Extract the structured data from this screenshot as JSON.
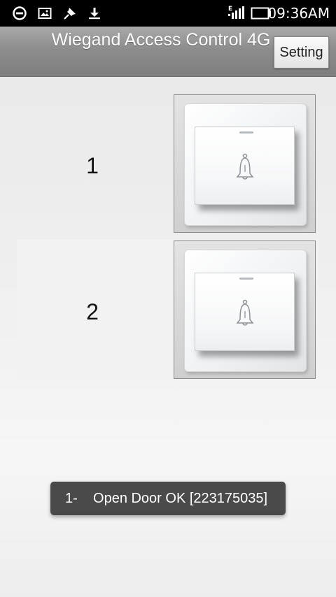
{
  "status_bar": {
    "time": "09:36AM",
    "icons": [
      "circle-minus-icon",
      "image-icon",
      "pin-icon",
      "download-icon",
      "signal-e-icon",
      "battery-icon"
    ]
  },
  "header": {
    "title": "Wiegand Access Control 4G",
    "setting_label": "Setting"
  },
  "doors": [
    {
      "number": "1",
      "icon": "bell-icon"
    },
    {
      "number": "2",
      "icon": "bell-icon"
    }
  ],
  "toast": {
    "text": "1-    Open Door OK [223175035]"
  },
  "colors": {
    "status_bar": "#000000",
    "title_bar": "#8d8d8d",
    "toast_bg": "#3c3c3c"
  }
}
